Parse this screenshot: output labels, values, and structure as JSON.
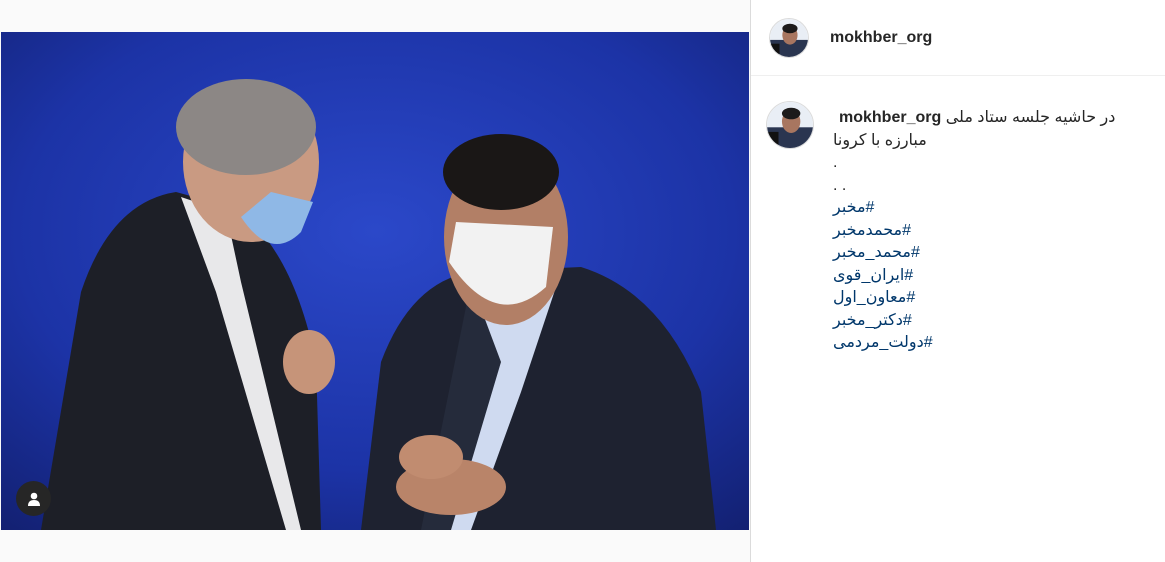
{
  "post": {
    "image_alt": "photo",
    "tag_icon": "user-tag-icon"
  },
  "header": {
    "username": "mokhber_org",
    "avatar_icon": "profile-avatar"
  },
  "caption": {
    "username": "mokhber_org",
    "text_line1": "در حاشیه جلسه ستاد ملی",
    "text_line2": "مبارزه با کرونا",
    "dot1": ".",
    "dot2": ". .",
    "hashtags": [
      "#مخبر",
      "#محمدمخبر",
      "#محمد_مخبر",
      "#ایران_قوی",
      "#معاون_اول",
      "#دکتر_مخبر",
      "#دولت_مردمی"
    ]
  },
  "colors": {
    "background": "#fafafa",
    "panel": "#ffffff",
    "text": "#262626",
    "hashtag": "#00376b",
    "photo_backdrop": "#1b2e9a"
  }
}
